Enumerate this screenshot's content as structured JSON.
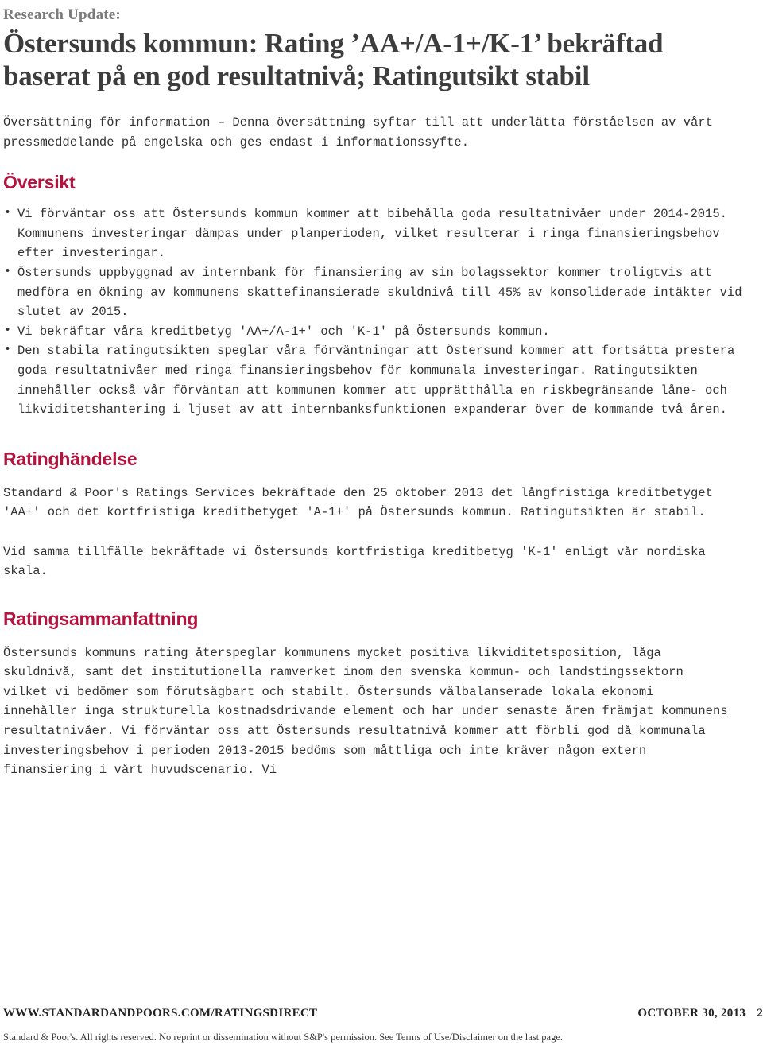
{
  "header": {
    "kicker": "Research Update:",
    "title": "Östersunds kommun: Rating ’AA+/A-1+/K-1’ bekräftad baserat på en god resultatnivå; Ratingutsikt stabil"
  },
  "intro": {
    "text": "Översättning för information – Denna översättning syftar till att underlätta förståelsen av vårt pressmeddelande på engelska och ges endast i informationssyfte."
  },
  "sections": {
    "overview": {
      "heading": "Översikt",
      "bullets": [
        "Vi förväntar oss att Östersunds kommun kommer att bibehålla goda resultatnivåer under 2014-2015. Kommunens investeringar dämpas under planperioden, vilket resulterar i ringa finansieringsbehov efter investeringar.",
        "Östersunds uppbyggnad av internbank för finansiering av sin bolagssektor kommer troligtvis att medföra en ökning av kommunens skattefinansierade skuldnivå till 45% av konsoliderade intäkter vid slutet av 2015.",
        "Vi bekräftar våra kreditbetyg 'AA+/A-1+' och 'K-1' på Östersunds kommun.",
        "Den stabila ratingutsikten speglar våra förväntningar att Östersund kommer att fortsätta prestera goda resultatnivåer med ringa finansieringsbehov för kommunala investeringar. Ratingutsikten innehåller också vår förväntan att kommunen kommer att upprätthålla en riskbegränsande låne- och likviditetshantering i ljuset av att internbanksfunktionen expanderar över de kommande två åren."
      ]
    },
    "rating_event": {
      "heading": "Ratinghändelse",
      "paragraphs": [
        "Standard & Poor's Ratings Services bekräftade den 25 oktober 2013 det långfristiga kreditbetyget 'AA+' och det kortfristiga kreditbetyget 'A-1+' på Östersunds kommun. Ratingutsikten är stabil.",
        "Vid samma tillfälle bekräftade vi Östersunds kortfristiga kreditbetyg 'K-1' enligt vår nordiska skala."
      ]
    },
    "rating_summary": {
      "heading": "Ratingsammanfattning",
      "paragraphs": [
        "Östersunds kommuns rating återspeglar kommunens mycket positiva likviditetsposition, låga skuldnivå, samt det institutionella ramverket inom den svenska kommun- och landstingssektorn vilket vi bedömer som förutsägbart och stabilt. Östersunds välbalanserade lokala ekonomi innehåller inga strukturella kostnadsdrivande element och har under senaste åren främjat kommunens resultatnivåer. Vi förväntar oss att  Östersunds resultatnivå kommer att förbli god då kommunala investeringsbehov i perioden 2013-2015 bedöms som måttliga och inte kräver någon extern finansiering i vårt huvudscenario. Vi"
      ]
    }
  },
  "footer": {
    "site": "WWW.STANDARDANDPOORS.COM/RATINGSDIRECT",
    "date": "OCTOBER 30, 2013",
    "page_number": "2",
    "legal": "Standard & Poor's. All rights reserved. No reprint or dissemination without S&P's permission. See Terms of Use/Disclaimer on the last page."
  },
  "colors": {
    "heading_red": "#b5123e",
    "title_gray": "#3d3d3d",
    "kicker_gray": "#7a7a7a",
    "body_text": "#333333"
  }
}
